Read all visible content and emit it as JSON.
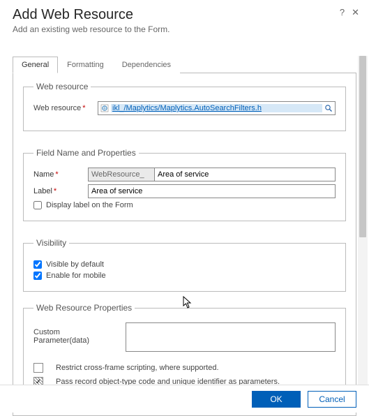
{
  "header": {
    "title": "Add Web Resource",
    "subtitle": "Add an existing web resource to the Form."
  },
  "tabs": {
    "general": "General",
    "formatting": "Formatting",
    "dependencies": "Dependencies"
  },
  "web_resource_section": {
    "legend": "Web resource",
    "label": "Web resource",
    "value": "ikl_/Maplytics/Maplytics.AutoSearchFilters.h"
  },
  "field_section": {
    "legend": "Field Name and Properties",
    "name_label": "Name",
    "name_prefix": "WebResource_",
    "name_value": "Area of service",
    "label_label": "Label",
    "label_value": "Area of service",
    "display_label_chk": "Display label on the Form",
    "display_label_checked": false
  },
  "visibility_section": {
    "legend": "Visibility",
    "visible_label": "Visible by default",
    "visible_checked": true,
    "mobile_label": "Enable for mobile",
    "mobile_checked": true
  },
  "properties_section": {
    "legend": "Web Resource Properties",
    "custom_param_label": "Custom Parameter(data)",
    "custom_param_value": "",
    "restrict_label": "Restrict cross-frame scripting, where supported.",
    "restrict_checked": false,
    "pass_record_label": "Pass record object-type code and unique identifier as parameters.",
    "pass_record_checked": true
  },
  "footer": {
    "ok": "OK",
    "cancel": "Cancel"
  }
}
